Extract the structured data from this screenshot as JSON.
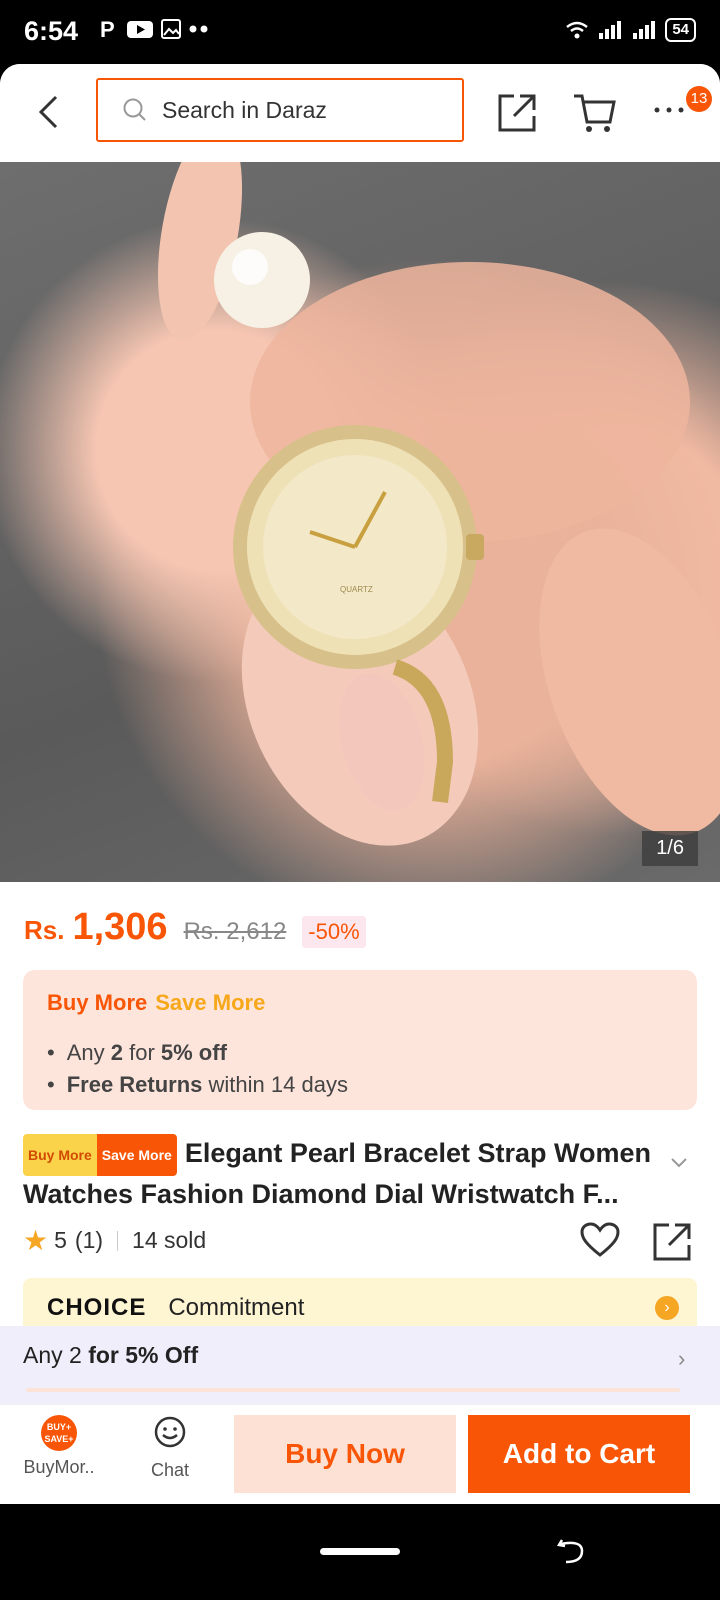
{
  "status": {
    "time": "6:54",
    "battery": "54"
  },
  "header": {
    "search_placeholder": "Search in Daraz",
    "cart_badge": "13"
  },
  "gallery": {
    "counter": "1/6",
    "watch_brand": "QUARTZ"
  },
  "price": {
    "currency": "Rs.",
    "current": "1,306",
    "original": "Rs. 2,612",
    "discount": "-50%"
  },
  "promo": {
    "title_part1": "Buy More",
    "title_part2": "Save More",
    "line1_pre": "Any ",
    "line1_qty": "2",
    "line1_mid": " for ",
    "line1_off": "5% off",
    "line2_bold": "Free Returns",
    "line2_rest": " within 14 days"
  },
  "product": {
    "tag_part1": "Buy More",
    "tag_part2": "Save More",
    "title": "Elegant Pearl Bracelet Strap Women Watches Fashion Diamond Dial Wristwatch F..."
  },
  "rating": {
    "score": "5",
    "count": "(1)",
    "sold": "14 sold"
  },
  "choice": {
    "logo": "CHOICE",
    "text": "Commitment"
  },
  "offer": {
    "pre": "Any 2 ",
    "bold": "for 5% Off"
  },
  "bottom": {
    "buymore_label": "BuyMor..",
    "buymore_icon": "BUY+ SAVE+",
    "chat_label": "Chat",
    "buy_now": "Buy Now",
    "add_to_cart": "Add to Cart"
  },
  "colors": {
    "accent": "#f85606",
    "promo_bg": "#fde5dc",
    "choice_bg": "#fef5d3",
    "offer_bg": "#f1eefb"
  }
}
